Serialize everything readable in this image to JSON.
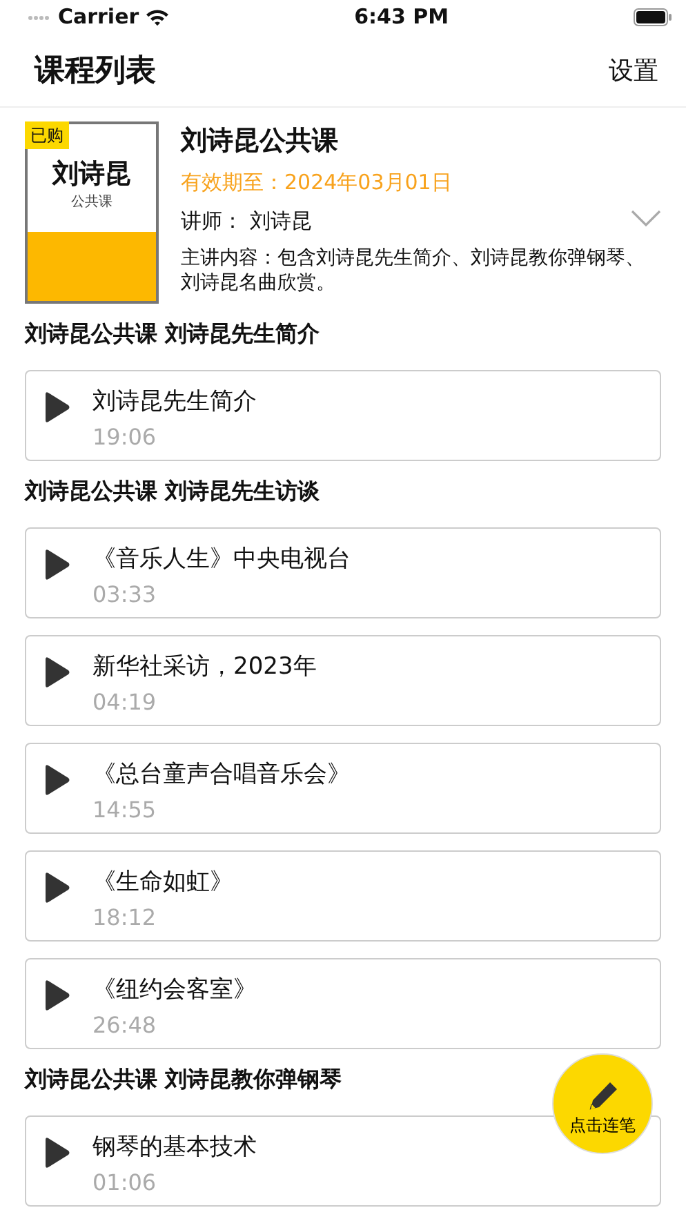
{
  "status_bar": {
    "carrier": "Carrier",
    "time": "6:43 PM"
  },
  "nav": {
    "title": "课程列表",
    "action": "设置"
  },
  "course": {
    "cover_title": "刘诗昆",
    "cover_subtitle": "公共课",
    "badge": "已购",
    "title": "刘诗昆公共课",
    "validity": "有效期至：2024年03月01日",
    "teacher": "讲师：  刘诗昆",
    "content": "主讲内容：包含刘诗昆先生简介、刘诗昆教你弹钢琴、刘诗昆名曲欣赏。",
    "expanded": false
  },
  "sections": [
    {
      "title": "刘诗昆公共课 刘诗昆先生简介",
      "lessons": [
        {
          "title": "刘诗昆先生简介",
          "duration": "19:06"
        }
      ]
    },
    {
      "title": "刘诗昆公共课 刘诗昆先生访谈",
      "lessons": [
        {
          "title": "《音乐人生》中央电视台",
          "duration": "03:33"
        },
        {
          "title": "新华社采访，2023年",
          "duration": "04:19"
        },
        {
          "title": "《总台童声合唱音乐会》",
          "duration": "14:55"
        },
        {
          "title": "《生命如虹》",
          "duration": "18:12"
        },
        {
          "title": "《纽约会客室》",
          "duration": "26:48"
        }
      ]
    },
    {
      "title": "刘诗昆公共课 刘诗昆教你弹钢琴",
      "lessons": [
        {
          "title": "钢琴的基本技术",
          "duration": "01:06"
        }
      ]
    }
  ],
  "fab": {
    "label": "点击连笔"
  }
}
